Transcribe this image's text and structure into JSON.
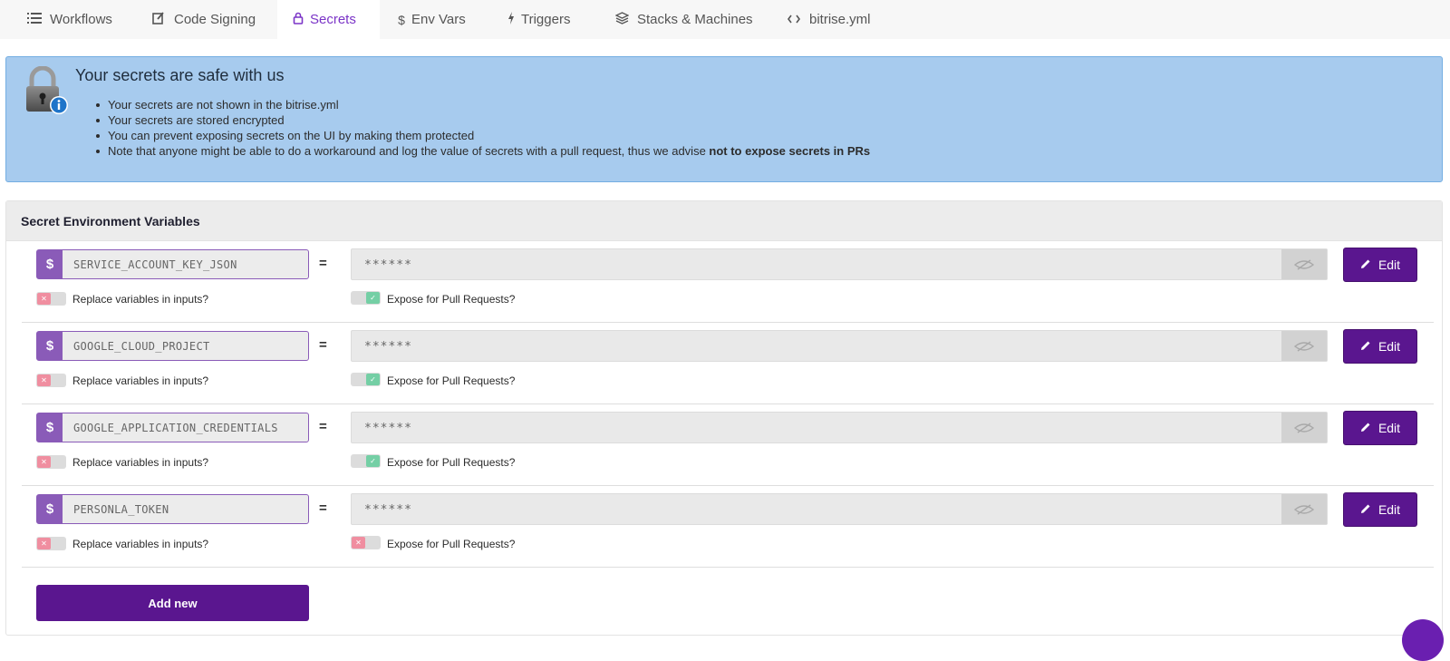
{
  "tabs": [
    {
      "label": "Workflows",
      "icon": "list-icon",
      "active": false
    },
    {
      "label": "Code Signing",
      "icon": "edit-icon",
      "active": false
    },
    {
      "label": "Secrets",
      "icon": "lock-icon",
      "active": true
    },
    {
      "label": "Env Vars",
      "icon": "dollar-icon",
      "active": false
    },
    {
      "label": "Triggers",
      "icon": "bolt-icon",
      "active": false
    },
    {
      "label": "Stacks & Machines",
      "icon": "layers-icon",
      "active": false
    },
    {
      "label": "bitrise.yml",
      "icon": "code-icon",
      "active": false
    }
  ],
  "info": {
    "title": "Your secrets are safe with us",
    "items": [
      "Your secrets are not shown in the bitrise.yml",
      "Your secrets are stored encrypted",
      "You can prevent exposing secrets on the UI by making them protected"
    ],
    "note_text": "Note that anyone might be able to do a workaround and log the value of secrets with a pull request, thus we advise ",
    "note_bold": "not to expose secrets in PRs"
  },
  "panel": {
    "title": "Secret Environment Variables",
    "dollar_symbol": "$",
    "equals_symbol": "=",
    "edit_label": "Edit",
    "replace_label": "Replace variables in inputs?",
    "expose_label": "Expose for Pull Requests?",
    "add_new_label": "Add new",
    "secrets": [
      {
        "key": "SERVICE_ACCOUNT_KEY_JSON",
        "value": "******",
        "replace": false,
        "expose": true
      },
      {
        "key": "GOOGLE_CLOUD_PROJECT",
        "value": "******",
        "replace": false,
        "expose": true
      },
      {
        "key": "GOOGLE_APPLICATION_CREDENTIALS",
        "value": "******",
        "replace": false,
        "expose": true
      },
      {
        "key": "PERSONLA_TOKEN",
        "value": "******",
        "replace": false,
        "expose": false
      }
    ]
  },
  "colors": {
    "accent": "#7b34c7",
    "button": "#5a168f",
    "info_bg": "#a7cbee",
    "toggle_off": "#f08ea0",
    "toggle_on": "#74cfa5"
  }
}
